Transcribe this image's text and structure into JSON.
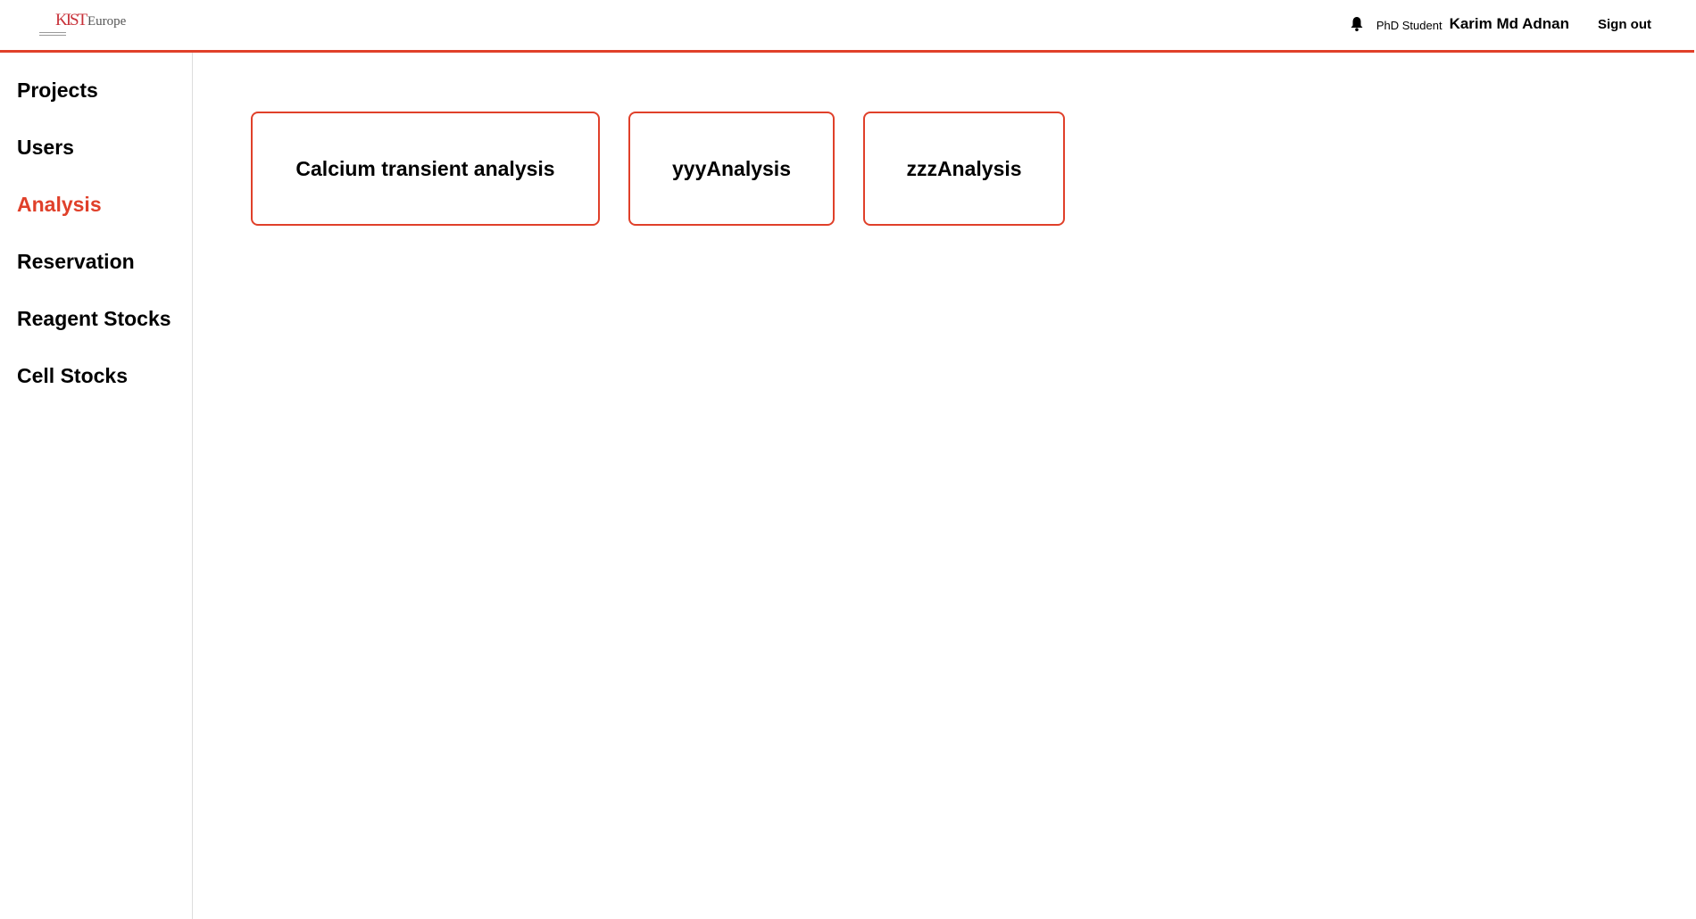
{
  "header": {
    "logo_text": "Europe",
    "logo_mark": "KIST",
    "role": "PhD Student",
    "user_name": "Karim Md Adnan",
    "sign_out": "Sign out"
  },
  "sidebar": {
    "items": [
      {
        "label": "Projects",
        "active": false
      },
      {
        "label": "Users",
        "active": false
      },
      {
        "label": "Analysis",
        "active": true
      },
      {
        "label": "Reservation",
        "active": false
      },
      {
        "label": "Reagent Stocks",
        "active": false
      },
      {
        "label": "Cell Stocks",
        "active": false
      }
    ]
  },
  "main": {
    "cards": [
      {
        "label": "Calcium transient analysis"
      },
      {
        "label": "yyyAnalysis"
      },
      {
        "label": "zzzAnalysis"
      }
    ]
  },
  "colors": {
    "accent": "#e0402a",
    "text": "#000000",
    "background": "#ffffff"
  },
  "icons": {
    "notification": "bell-icon"
  }
}
